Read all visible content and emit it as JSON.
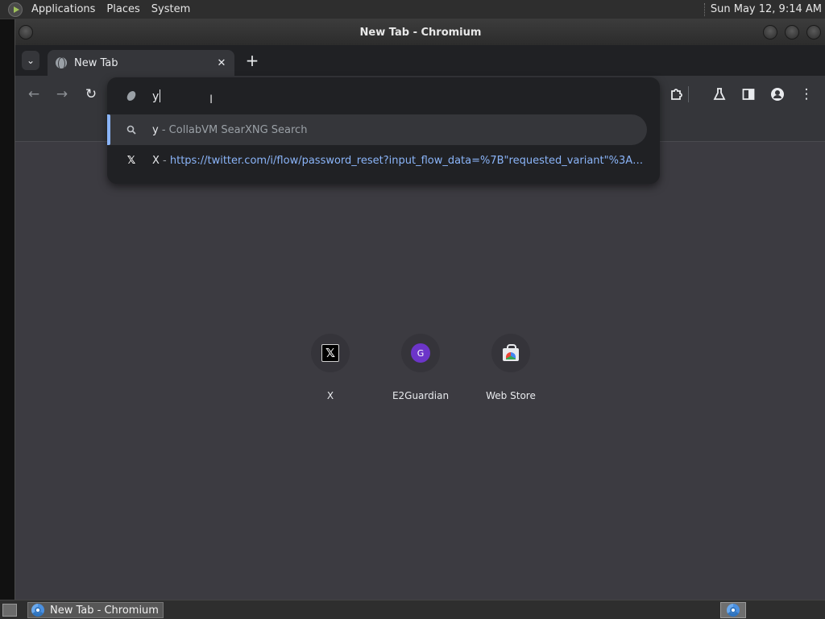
{
  "top_panel": {
    "menus": [
      "Applications",
      "Places",
      "System"
    ],
    "clock": "Sun May 12,  9:14 AM"
  },
  "window": {
    "title": "New Tab - Chromium"
  },
  "tabs": [
    {
      "title": "New Tab",
      "icon": "globe-icon",
      "active": true
    }
  ],
  "omnibox": {
    "text": "y",
    "suggestions": [
      {
        "icon": "search-icon",
        "text": "y",
        "separator": " - ",
        "description": "CollabVM SearXNG Search",
        "selected": true
      },
      {
        "icon": "x-logo-icon",
        "text": "X",
        "separator": " - ",
        "url": "https://twitter.com/i/flow/password_reset?input_flow_data=%7B\"requested_variant\"%3A\"e..."
      }
    ]
  },
  "shortcuts": [
    {
      "label": "X",
      "icon": "x-logo-icon"
    },
    {
      "label": "E2Guardian",
      "icon": "e2guardian-icon",
      "letter": "G"
    },
    {
      "label": "Web Store",
      "icon": "web-store-icon"
    }
  ],
  "taskbar": {
    "task_label": "New Tab - Chromium"
  },
  "colors": {
    "accent": "#8ab4f8",
    "popup_bg": "#202124",
    "toolbar_bg": "#35363a",
    "ntp_bg": "#3c3b41"
  }
}
